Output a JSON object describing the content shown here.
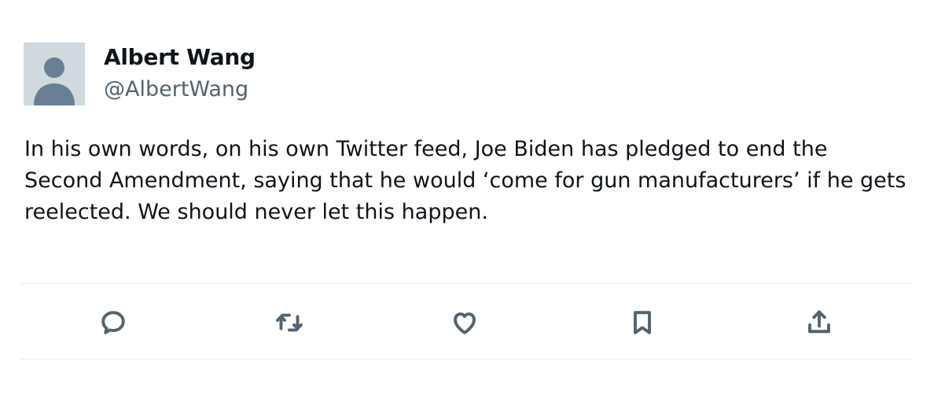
{
  "author": {
    "display_name": "Albert Wang",
    "handle": "@AlbertWang",
    "avatar_icon": "default-user-silhouette"
  },
  "tweet": {
    "text": "In his own words, on his own Twitter feed, Joe Biden has pledged to end the Second Amendment, saying that he would ‘come for gun manufacturers’ if he gets reelected. We should never let this happen."
  },
  "actions": [
    {
      "name": "reply",
      "icon": "speech-bubble-icon"
    },
    {
      "name": "retweet",
      "icon": "retweet-arrows-icon"
    },
    {
      "name": "like",
      "icon": "heart-icon"
    },
    {
      "name": "bookmark",
      "icon": "bookmark-icon"
    },
    {
      "name": "share",
      "icon": "share-upload-icon"
    }
  ],
  "colors": {
    "text": "#0f1419",
    "secondary": "#536471",
    "avatar_bg": "#cfd9de",
    "avatar_fg": "#687f96",
    "divider": "#e6ecf0"
  }
}
